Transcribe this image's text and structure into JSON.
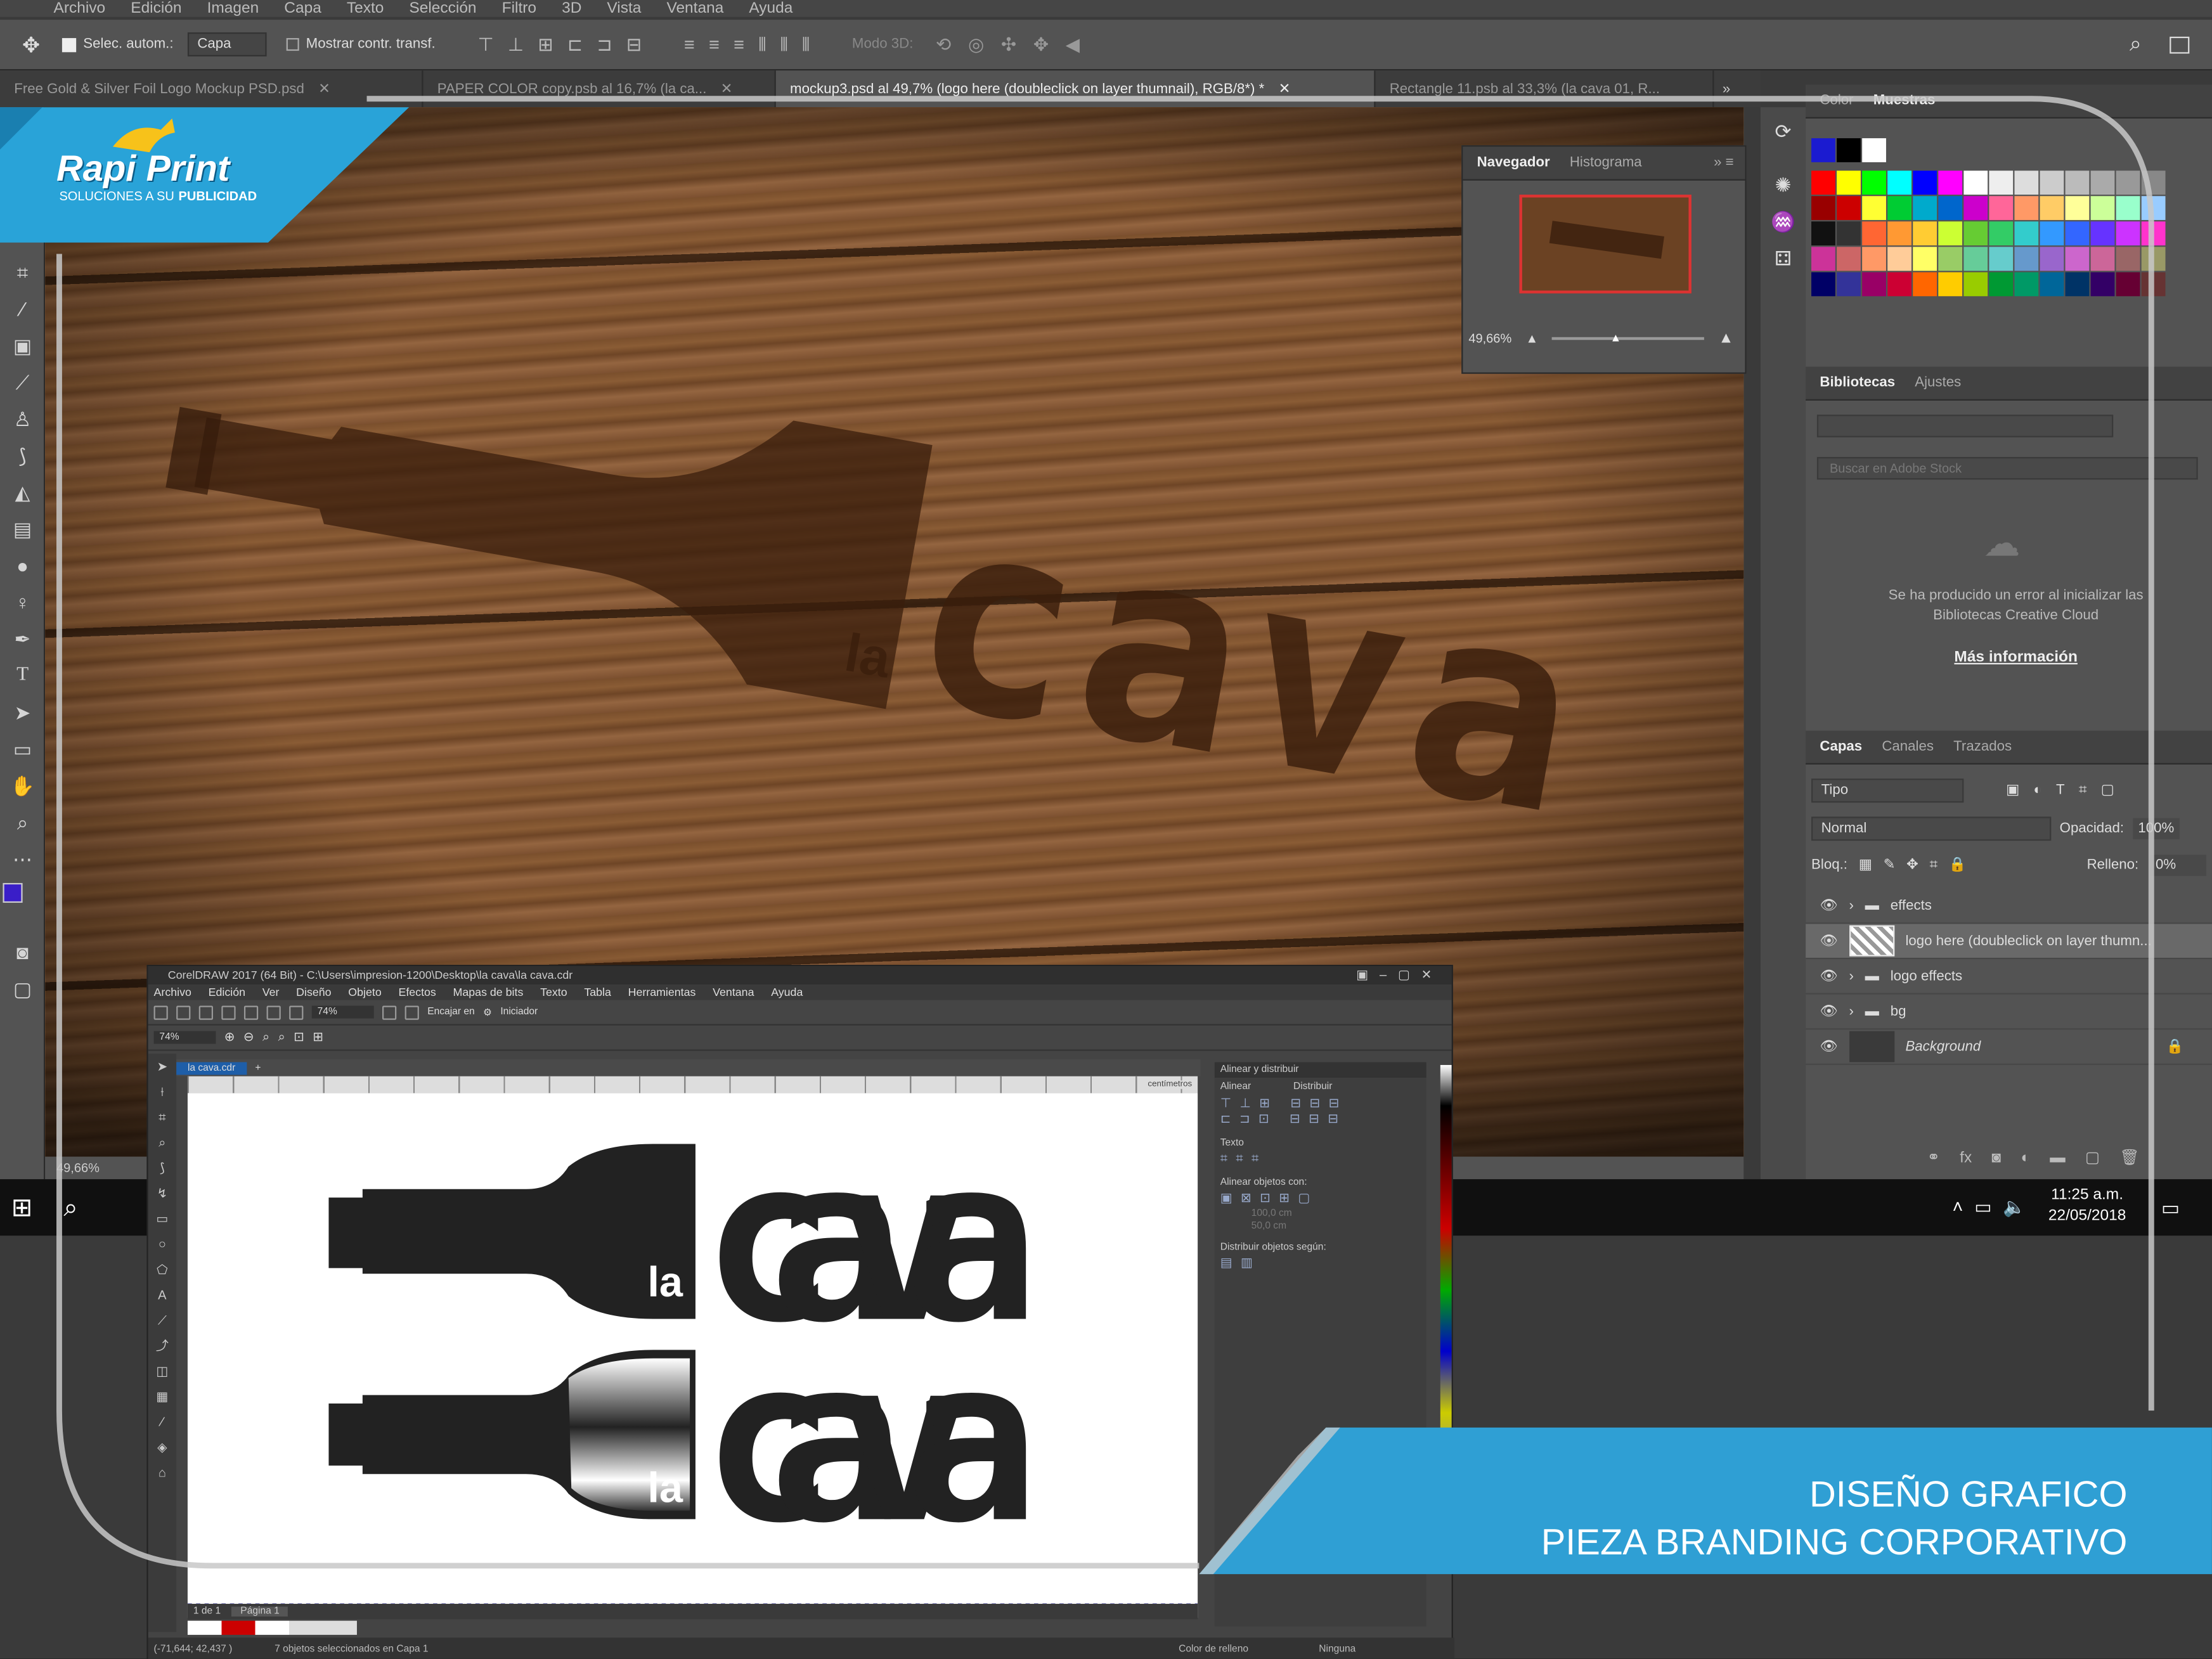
{
  "brand": {
    "name": "Rapi Print",
    "tagline": "SOLUCIONES A SU",
    "tagline_strong": "PUBLICIDAD"
  },
  "banner": {
    "line1": "DISEÑO GRAFICO",
    "line2": "PIEZA BRANDING CORPORATIVO"
  },
  "photoshop": {
    "menu": [
      "Archivo",
      "Edición",
      "Imagen",
      "Capa",
      "Texto",
      "Selección",
      "Filtro",
      "3D",
      "Vista",
      "Ventana",
      "Ayuda"
    ],
    "options": {
      "auto_select": "Selec. autom.:",
      "auto_select_value": "Capa",
      "show_transform": "Mostrar contr. transf.",
      "mode_3d": "Modo 3D:"
    },
    "tabs": [
      {
        "label": "Free Gold & Silver Foil Logo Mockup PSD.psd"
      },
      {
        "label": "PAPER COLOR copy.psb al 16,7% (la ca..."
      },
      {
        "label": "mockup3.psd al 49,7% (logo here (doubleclick on layer thumnail), RGB/8*) *"
      },
      {
        "label": "Rectangle 11.psb al 33,3% (la cava 01, R..."
      }
    ],
    "canvas_logo": {
      "small": "la",
      "big": "cava"
    },
    "zoom_status": "49,66%",
    "navigator": {
      "tabs": [
        "Navegador",
        "Histograma"
      ],
      "zoom": "49,66%"
    },
    "swatches": {
      "tabs": [
        "Color",
        "Muestras"
      ]
    },
    "libraries": {
      "tabs": [
        "Bibliotecas",
        "Ajustes"
      ],
      "search_placeholder": "Buscar en Adobe Stock",
      "error": "Se ha producido un error al inicializar las Bibliotecas Creative Cloud",
      "link": "Más información"
    },
    "layers": {
      "tabs": [
        "Capas",
        "Canales",
        "Trazados"
      ],
      "filter": "Tipo",
      "blend": "Normal",
      "opacity_label": "Opacidad:",
      "opacity": "100%",
      "lock_label": "Bloq.:",
      "fill_label": "Relleno:",
      "fill": "0%",
      "items": [
        {
          "name": "effects"
        },
        {
          "name": "logo here (doubleclick on layer thumn..."
        },
        {
          "name": "logo effects"
        },
        {
          "name": "bg"
        },
        {
          "name": "Background"
        }
      ]
    }
  },
  "taskbar": {
    "time": "11:25 a.m.",
    "date": "22/05/2018"
  },
  "corel": {
    "title": "CorelDRAW 2017 (64 Bit) - C:\\Users\\impresion-1200\\Desktop\\la cava\\la cava.cdr",
    "menu": [
      "Archivo",
      "Edición",
      "Ver",
      "Diseño",
      "Objeto",
      "Efectos",
      "Mapas de bits",
      "Texto",
      "Tabla",
      "Herramientas",
      "Ventana",
      "Ayuda"
    ],
    "zoom": "74%",
    "snap": "Encajar en",
    "launcher": "Iniciador",
    "doc_tab": "la cava.cdr",
    "ruler_unit": "centímetros",
    "logo_small": "la",
    "logo_big": "cava",
    "side_panel": {
      "title": "Alinear y distribuir",
      "align": "Alinear",
      "distribute": "Distribuir",
      "text": "Texto",
      "align_to": "Alinear objetos con:",
      "dist_to": "Distribuir objetos según:",
      "x": "100,0 cm",
      "y": "50,0 cm"
    },
    "page": {
      "nav": "1 de 1",
      "label": "Página 1"
    },
    "status": {
      "coords": "(-71,644; 42,437 )",
      "selection": "7 objetos seleccionados en Capa 1",
      "fill": "Color de relleno",
      "outline": "Ninguna"
    }
  }
}
